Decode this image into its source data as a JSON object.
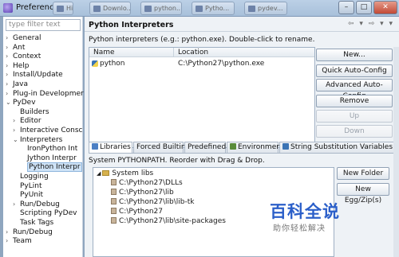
{
  "window": {
    "title": "Preferences",
    "taskbar_tabs": [
      "Hi",
      "Downlo...",
      "python...",
      "Pytho...",
      "pydev..."
    ],
    "controls": {
      "min": "–",
      "max": "□",
      "close": "✕"
    }
  },
  "left": {
    "filter_placeholder": "type filter text",
    "tree": [
      {
        "label": "General",
        "indent": 0,
        "arrow": "›"
      },
      {
        "label": "Ant",
        "indent": 0,
        "arrow": "›"
      },
      {
        "label": "Context",
        "indent": 0,
        "arrow": "›"
      },
      {
        "label": "Help",
        "indent": 0,
        "arrow": "›"
      },
      {
        "label": "Install/Update",
        "indent": 0,
        "arrow": "›"
      },
      {
        "label": "Java",
        "indent": 0,
        "arrow": "›"
      },
      {
        "label": "Plug-in Developmer",
        "indent": 0,
        "arrow": "›"
      },
      {
        "label": "PyDev",
        "indent": 0,
        "arrow": "⌄"
      },
      {
        "label": "Builders",
        "indent": 1,
        "arrow": ""
      },
      {
        "label": "Editor",
        "indent": 1,
        "arrow": "›"
      },
      {
        "label": "Interactive Consc",
        "indent": 1,
        "arrow": "›"
      },
      {
        "label": "Interpreters",
        "indent": 1,
        "arrow": "⌄"
      },
      {
        "label": "IronPython Int",
        "indent": 2,
        "arrow": ""
      },
      {
        "label": "Jython Interpr",
        "indent": 2,
        "arrow": ""
      },
      {
        "label": "Python Interpr",
        "indent": 2,
        "arrow": "",
        "selected": true
      },
      {
        "label": "Logging",
        "indent": 1,
        "arrow": ""
      },
      {
        "label": "PyLint",
        "indent": 1,
        "arrow": ""
      },
      {
        "label": "PyUnit",
        "indent": 1,
        "arrow": ""
      },
      {
        "label": "Run/Debug",
        "indent": 1,
        "arrow": "›"
      },
      {
        "label": "Scripting PyDev",
        "indent": 1,
        "arrow": ""
      },
      {
        "label": "Task Tags",
        "indent": 1,
        "arrow": ""
      },
      {
        "label": "Run/Debug",
        "indent": 0,
        "arrow": "›"
      },
      {
        "label": "Team",
        "indent": 0,
        "arrow": "›"
      }
    ]
  },
  "right": {
    "heading": "Python Interpreters",
    "nav": "⇦ ▾ ⇨ ▾ ▾",
    "description": "Python interpreters (e.g.: python.exe).  Double-click to rename.",
    "table": {
      "columns": [
        "Name",
        "Location"
      ],
      "rows": [
        {
          "name": "python",
          "location": "C:\\Python27\\python.exe"
        }
      ]
    },
    "buttons": [
      {
        "label": "New...",
        "enabled": true
      },
      {
        "label": "Quick Auto-Config",
        "enabled": true
      },
      {
        "label": "Advanced Auto-Config",
        "enabled": true
      },
      {
        "label": "Remove",
        "enabled": true
      },
      {
        "label": "Up",
        "enabled": false
      },
      {
        "label": "Down",
        "enabled": false
      }
    ],
    "tabs": [
      {
        "label": "Libraries",
        "active": true,
        "icon_color": "#4b7fc4"
      },
      {
        "label": "Forced Builtins",
        "active": false
      },
      {
        "label": "Predefined",
        "active": false
      },
      {
        "label": "Environment",
        "active": false,
        "icon_color": "#5a8c3a"
      },
      {
        "label": "String Substitution Variables",
        "active": false,
        "icon_color": "#3b74b5"
      }
    ],
    "pythonpath_label": "System PYTHONPATH.  Reorder with Drag & Drop.",
    "libs": {
      "root": "System libs",
      "items": [
        "C:\\Python27\\DLLs",
        "C:\\Python27\\lib",
        "C:\\Python27\\lib\\lib-tk",
        "C:\\Python27",
        "C:\\Python27\\lib\\site-packages"
      ]
    },
    "lib_buttons": [
      "New Folder",
      "New Egg/Zip(s)"
    ]
  },
  "watermark": {
    "big": "百科全说",
    "small": "助你轻松解决"
  }
}
